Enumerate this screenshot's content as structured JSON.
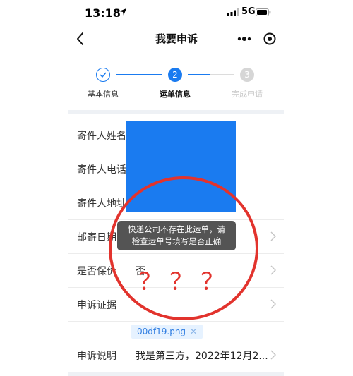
{
  "status_bar": {
    "time": "13:18",
    "network": "5G"
  },
  "nav": {
    "title": "我要申诉"
  },
  "steps": [
    {
      "number": "1",
      "label": "基本信息",
      "state": "done"
    },
    {
      "number": "2",
      "label": "运单信息",
      "state": "active"
    },
    {
      "number": "3",
      "label": "完成申请",
      "state": "pending"
    }
  ],
  "form": {
    "rows": [
      {
        "label": "寄件人姓名",
        "value": ""
      },
      {
        "label": "寄件人电话",
        "value": ""
      },
      {
        "label": "寄件人地址",
        "value": ""
      },
      {
        "label": "邮寄日期",
        "value": ""
      },
      {
        "label": "是否保价",
        "value": "否"
      },
      {
        "label": "申诉证据",
        "value": ""
      },
      {
        "label": "申诉说明",
        "value": "我是第三方，2022年12月2..."
      }
    ],
    "attachment": "00df19.png"
  },
  "toast": {
    "line1": "快递公司不存在此运单，请",
    "line2": "检查运单号填写是否正确"
  },
  "annotation": {
    "marks": "？？？"
  },
  "colors": {
    "accent": "#1a7bf0",
    "annotation_red": "#e2332d",
    "pending": "#cccccc"
  }
}
